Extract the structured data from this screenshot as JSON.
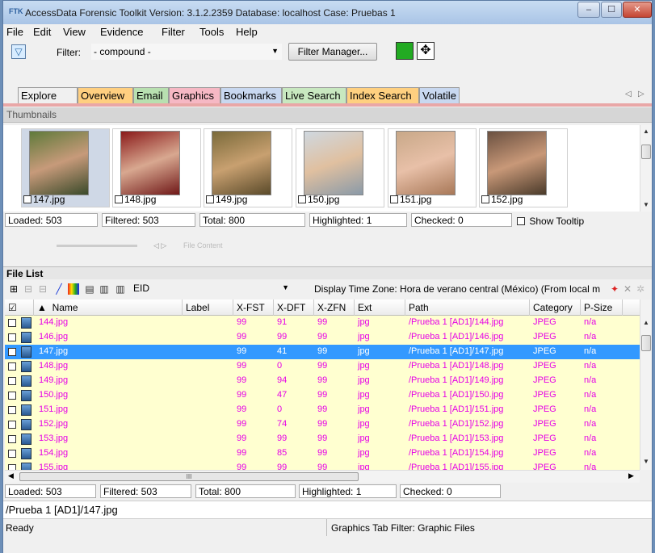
{
  "window": {
    "title": "AccessData Forensic Toolkit Version: 3.1.2.2359 Database: localhost Case: Pruebas 1",
    "app_icon_text": "FTK",
    "controls": {
      "minimize": "–",
      "maximize": "☐",
      "close": "✕"
    }
  },
  "menu": [
    "File",
    "Edit",
    "View",
    "Evidence",
    "Filter",
    "Tools",
    "Help"
  ],
  "toolbar": {
    "filter_label": "Filter:",
    "filter_value": "- compound -",
    "filter_manager_label": "Filter Manager..."
  },
  "tabs": [
    {
      "label": "Explore",
      "color": "#f0f0f0"
    },
    {
      "label": "Overview",
      "color": "#ffcf80"
    },
    {
      "label": "Email",
      "color": "#b8e0b0"
    },
    {
      "label": "Graphics",
      "color": "#f6b8c4"
    },
    {
      "label": "Bookmarks",
      "color": "#c8d8f0"
    },
    {
      "label": "Live Search",
      "color": "#c8e8c0"
    },
    {
      "label": "Index Search",
      "color": "#ffd080"
    },
    {
      "label": "Volatile",
      "color": "#c8d8f0"
    }
  ],
  "tab_scroll": {
    "left": "◁",
    "right": "▷"
  },
  "thumbnails": {
    "header": "Thumbnails",
    "items": [
      {
        "name": "147.jpg",
        "selected": true
      },
      {
        "name": "148.jpg",
        "selected": false
      },
      {
        "name": "149.jpg",
        "selected": false
      },
      {
        "name": "150.jpg",
        "selected": false
      },
      {
        "name": "151.jpg",
        "selected": false
      },
      {
        "name": "152.jpg",
        "selected": false
      }
    ],
    "status": {
      "loaded": "Loaded: 503",
      "filtered": "Filtered: 503",
      "total": "Total: 800",
      "highlighted": "Highlighted: 1",
      "checked": "Checked: 0",
      "show_tooltip": "Show Tooltip"
    },
    "file_content_label": "File Content"
  },
  "file_list": {
    "header": "File List",
    "column_preset": "EID",
    "time_zone": "Display Time Zone: Hora de verano central (México)  (From local m",
    "columns": [
      "Name",
      "Label",
      "X-FST",
      "X-DFT",
      "X-ZFN",
      "Ext",
      "Path",
      "Category",
      "P-Size"
    ],
    "rows": [
      {
        "name": "144.jpg",
        "label": "",
        "xfst": "99",
        "xdft": "91",
        "xzfn": "99",
        "ext": "jpg",
        "path": "/Prueba 1 [AD1]/144.jpg",
        "category": "JPEG",
        "psize": "n/a",
        "selected": false
      },
      {
        "name": "146.jpg",
        "label": "",
        "xfst": "99",
        "xdft": "99",
        "xzfn": "99",
        "ext": "jpg",
        "path": "/Prueba 1 [AD1]/146.jpg",
        "category": "JPEG",
        "psize": "n/a",
        "selected": false
      },
      {
        "name": "147.jpg",
        "label": "",
        "xfst": "99",
        "xdft": "41",
        "xzfn": "99",
        "ext": "jpg",
        "path": "/Prueba 1 [AD1]/147.jpg",
        "category": "JPEG",
        "psize": "n/a",
        "selected": true
      },
      {
        "name": "148.jpg",
        "label": "",
        "xfst": "99",
        "xdft": "0",
        "xzfn": "99",
        "ext": "jpg",
        "path": "/Prueba 1 [AD1]/148.jpg",
        "category": "JPEG",
        "psize": "n/a",
        "selected": false
      },
      {
        "name": "149.jpg",
        "label": "",
        "xfst": "99",
        "xdft": "94",
        "xzfn": "99",
        "ext": "jpg",
        "path": "/Prueba 1 [AD1]/149.jpg",
        "category": "JPEG",
        "psize": "n/a",
        "selected": false
      },
      {
        "name": "150.jpg",
        "label": "",
        "xfst": "99",
        "xdft": "47",
        "xzfn": "99",
        "ext": "jpg",
        "path": "/Prueba 1 [AD1]/150.jpg",
        "category": "JPEG",
        "psize": "n/a",
        "selected": false
      },
      {
        "name": "151.jpg",
        "label": "",
        "xfst": "99",
        "xdft": "0",
        "xzfn": "99",
        "ext": "jpg",
        "path": "/Prueba 1 [AD1]/151.jpg",
        "category": "JPEG",
        "psize": "n/a",
        "selected": false
      },
      {
        "name": "152.jpg",
        "label": "",
        "xfst": "99",
        "xdft": "74",
        "xzfn": "99",
        "ext": "jpg",
        "path": "/Prueba 1 [AD1]/152.jpg",
        "category": "JPEG",
        "psize": "n/a",
        "selected": false
      },
      {
        "name": "153.jpg",
        "label": "",
        "xfst": "99",
        "xdft": "99",
        "xzfn": "99",
        "ext": "jpg",
        "path": "/Prueba 1 [AD1]/153.jpg",
        "category": "JPEG",
        "psize": "n/a",
        "selected": false
      },
      {
        "name": "154.jpg",
        "label": "",
        "xfst": "99",
        "xdft": "85",
        "xzfn": "99",
        "ext": "jpg",
        "path": "/Prueba 1 [AD1]/154.jpg",
        "category": "JPEG",
        "psize": "n/a",
        "selected": false
      },
      {
        "name": "155.jpg",
        "label": "",
        "xfst": "99",
        "xdft": "99",
        "xzfn": "99",
        "ext": "jpg",
        "path": "/Prueba 1 [AD1]/155.jpg",
        "category": "JPEG",
        "psize": "n/a",
        "selected": false
      }
    ],
    "status": {
      "loaded": "Loaded: 503",
      "filtered": "Filtered: 503",
      "total": "Total: 800",
      "highlighted": "Highlighted: 1",
      "checked": "Checked: 0"
    },
    "hscroll_grip": "III"
  },
  "current_path": "/Prueba 1 [AD1]/147.jpg",
  "status_bar": {
    "left": "Ready",
    "right": "Graphics Tab Filter: Graphic Files"
  },
  "icons": [
    "filter-icon",
    "go-icon",
    "move-icon",
    "expand-icon",
    "collapse-icon",
    "edit-icon",
    "color-icon",
    "cut-icon",
    "copy-icon",
    "columns-icon",
    "sort-up-icon",
    "clear-icon",
    "settings-icon"
  ]
}
